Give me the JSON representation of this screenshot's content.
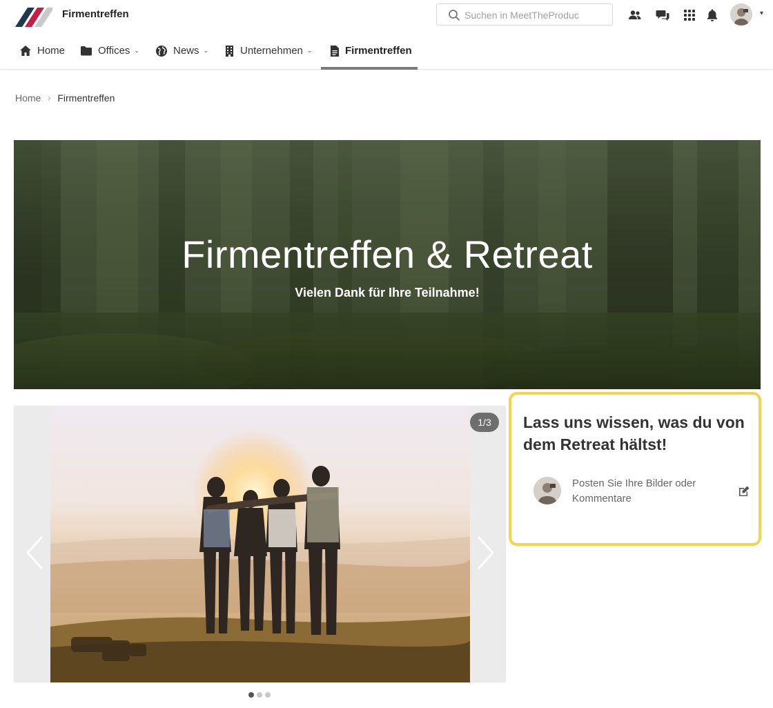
{
  "header": {
    "site_title": "Firmentreffen",
    "search_placeholder": "Suchen in MeetTheProduc",
    "icons": [
      "people-icon",
      "chat-icon",
      "apps-grid-icon",
      "bell-icon"
    ],
    "avatar_caret": "▾"
  },
  "nav": {
    "items": [
      {
        "label": "Home",
        "icon": "home-icon",
        "dropdown": false
      },
      {
        "label": "Offices",
        "icon": "folder-icon",
        "dropdown": true
      },
      {
        "label": "News",
        "icon": "globe-icon",
        "dropdown": true
      },
      {
        "label": "Unternehmen",
        "icon": "building-icon",
        "dropdown": true
      },
      {
        "label": "Firmentreffen",
        "icon": "document-icon",
        "dropdown": false,
        "active": true
      }
    ],
    "caret": "⌄"
  },
  "breadcrumb": {
    "items": [
      "Home",
      "Firmentreffen"
    ],
    "separator": "›"
  },
  "hero": {
    "title": "Firmentreffen & Retreat",
    "subtitle": "Vielen Dank für Ihre Teilnahme!"
  },
  "carousel": {
    "counter": "1/3",
    "current": 1,
    "total": 3
  },
  "feedback": {
    "title": "Lass uns wissen, was du von dem Retreat hältst!",
    "prompt": "Posten Sie Ihre Bilder oder Kommentare"
  },
  "colors": {
    "highlight_border": "#f4d44d",
    "nav_underline": "#7a7a7a",
    "logo_dark": "#1f3a4d",
    "logo_red": "#c81e45",
    "logo_grey": "#c9c9c9"
  }
}
